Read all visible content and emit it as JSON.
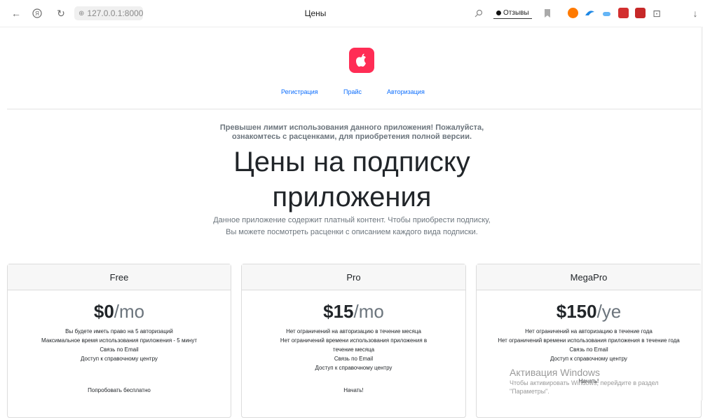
{
  "browser": {
    "url": "127.0.0.1:8000",
    "tab_title": "Цены",
    "reviews_label": "Отзывы",
    "icons": [
      "back-icon",
      "yandex-icon",
      "reload-icon",
      "site-info-icon",
      "search-icon",
      "bookmark-icon",
      "download-icon"
    ]
  },
  "nav": {
    "items": [
      "Регистрация",
      "Прайс",
      "Авторизация"
    ]
  },
  "hero": {
    "warning": "Превышен лимит использования данного приложения! Пожалуйста, ознакомтесь с расценками, для приобретения полной версии.",
    "title": "Цены на подписку приложения",
    "lead": "Данное приложение содержит платный контент. Чтобы приобрести подписку, Вы можете посмотреть расценки с описанием каждого вида подписки."
  },
  "plans": [
    {
      "name": "Free",
      "price": "$0",
      "period": "/mo",
      "features": [
        "Вы будете иметь право на 5 авторизаций",
        "Максимальное время использования приложения - 5 минут",
        "Связь по Email",
        "Доступ к справочному центру"
      ],
      "button": "Попробовать бесплатно"
    },
    {
      "name": "Pro",
      "price": "$15",
      "period": "/mo",
      "features": [
        "Нет ограничений на авторизацию в течение месяца",
        "Нет ограничений времени использования приложения в течение месяца",
        "Связь по Email",
        "Доступ к справочному центру"
      ],
      "button": "Начать!"
    },
    {
      "name": "MegaPro",
      "price": "$150",
      "period": "/ye",
      "features": [
        "Нет ограничений на авторизацию в течение года",
        "Нет ограничений времени использования приложения в течение года",
        "Связь по Email",
        "Доступ к справочному центру"
      ],
      "button": "Начать!"
    }
  ],
  "watermark": {
    "title": "Активация Windows",
    "subtitle": "Чтобы активировать Windows, перейдите в раздел \"Параметры\"."
  },
  "colors": {
    "logo": "#ff2d55",
    "link": "#0d6efd",
    "muted": "#6c757d"
  }
}
